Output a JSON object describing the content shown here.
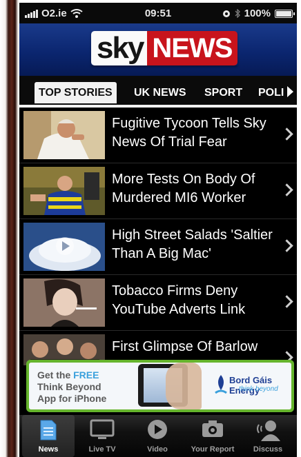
{
  "status_bar": {
    "carrier": "O2.ie",
    "time": "09:51",
    "battery": "100%"
  },
  "header": {
    "logo_left": "sky",
    "logo_right": "NEWS"
  },
  "tabs": [
    {
      "label": "TOP STORIES",
      "active": true
    },
    {
      "label": "UK NEWS"
    },
    {
      "label": "SPORT"
    },
    {
      "label": "POLI"
    }
  ],
  "stories": [
    {
      "title": "Fugitive Tycoon Tells Sky News Of Trial Fear",
      "thumb": "man-in-white-robe"
    },
    {
      "title": "More Tests On Body Of Murdered MI6 Worker",
      "thumb": "officer-in-yellow-vest"
    },
    {
      "title": "High Street Salads 'Saltier Than A Big Mac'",
      "thumb": "pile-of-salt-video"
    },
    {
      "title": "Tobacco Firms Deny YouTube Adverts Link",
      "thumb": "woman-with-cigarette"
    },
    {
      "title": "First Glimpse Of Barlow",
      "thumb": "people-crowd"
    }
  ],
  "ad": {
    "line1_prefix": "Get the ",
    "line1_highlight": "FREE",
    "line2": "Think Beyond",
    "line3": "App for iPhone",
    "brand": "Bord Gáis Energy",
    "tagline": "think beyond",
    "colors": {
      "border": "#66b52d",
      "highlight": "#3aa0dc",
      "brand": "#1f3f94"
    }
  },
  "tab_bar": [
    {
      "label": "News",
      "icon": "news-icon",
      "active": true
    },
    {
      "label": "Live TV",
      "icon": "tv-icon"
    },
    {
      "label": "Video",
      "icon": "play-icon"
    },
    {
      "label": "Your Report",
      "icon": "camera-icon"
    },
    {
      "label": "Discuss",
      "icon": "discuss-icon"
    }
  ],
  "colors": {
    "header_blue": "#0b2670",
    "news_red": "#c8141c",
    "background": "#000000"
  }
}
